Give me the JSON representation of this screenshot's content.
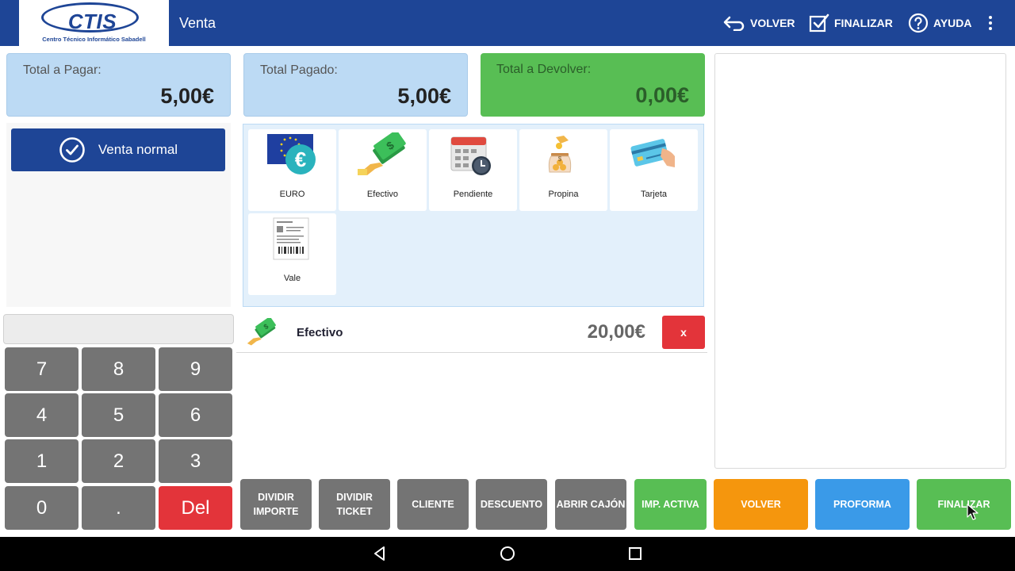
{
  "header": {
    "logo_text": "CTIS",
    "logo_subtitle": "Centro Técnico Informático Sabadell",
    "title": "Venta",
    "actions": {
      "volver": "VOLVER",
      "finalizar": "FINALIZAR",
      "ayuda": "AYUDA"
    }
  },
  "summary": {
    "total_pagar": {
      "label": "Total a Pagar:",
      "value": "5,00€"
    },
    "total_pagado": {
      "label": "Total Pagado:",
      "value": "5,00€"
    },
    "total_devolver": {
      "label": "Total a Devolver:",
      "value": "0,00€"
    }
  },
  "sale_type": {
    "label": "Venta normal"
  },
  "keypad": {
    "display": "",
    "keys": [
      "7",
      "8",
      "9",
      "4",
      "5",
      "6",
      "1",
      "2",
      "3",
      "0",
      ".",
      "Del"
    ]
  },
  "payment_methods": [
    {
      "label": "EURO",
      "icon": "euro-flag-icon"
    },
    {
      "label": "Efectivo",
      "icon": "cash-hand-icon"
    },
    {
      "label": "Pendiente",
      "icon": "calendar-clock-icon"
    },
    {
      "label": "Propina",
      "icon": "tip-jar-icon"
    },
    {
      "label": "Tarjeta",
      "icon": "credit-card-icon"
    },
    {
      "label": "Vale",
      "icon": "voucher-receipt-icon"
    }
  ],
  "payment_lines": [
    {
      "name": "Efectivo",
      "amount": "20,00€",
      "remove_label": "x"
    }
  ],
  "actions": {
    "dividir_importe": "DIVIDIR IMPORTE",
    "dividir_ticket": "DIVIDIR TICKET",
    "cliente": "CLIENTE",
    "descuento": "DESCUENTO",
    "abrir_cajon": "ABRIR CAJÓN",
    "imp_activa": "IMP. ACTIVA",
    "volver": "VOLVER",
    "proforma": "PROFORMA",
    "finalizar": "FINALIZAR"
  },
  "colors": {
    "header_blue": "#1e4596",
    "card_blue": "#bcdaf4",
    "card_green": "#58be54",
    "key_gray": "#747474",
    "delete_red": "#e3343a",
    "orange": "#f5960d",
    "blue": "#3a9ae8"
  }
}
